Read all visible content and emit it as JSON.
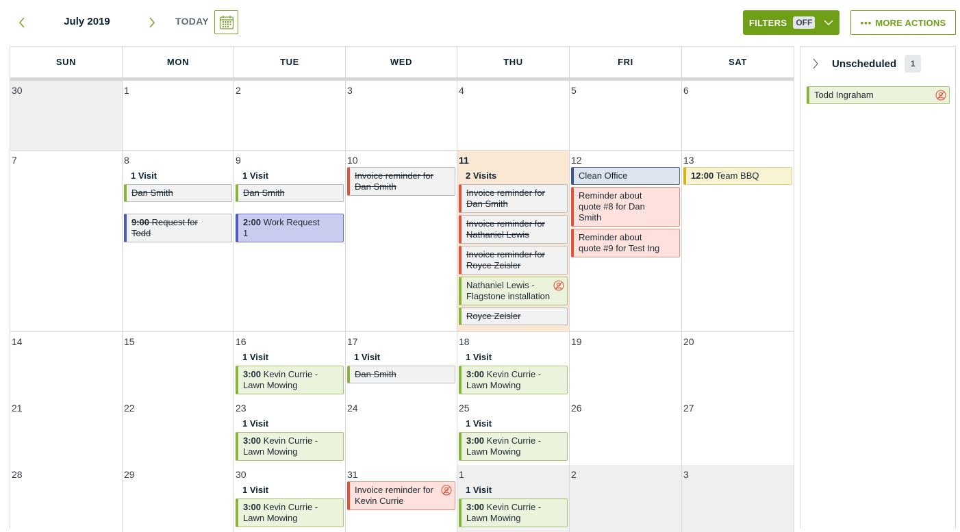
{
  "toolbar": {
    "month_title": "July 2019",
    "today_label": "TODAY",
    "filters_label": "FILTERS",
    "filters_state": "OFF",
    "more_actions_label": "MORE ACTIONS",
    "more_actions_dots": "•••"
  },
  "colors": {
    "brand_green": "#6f9f16",
    "today_bg": "#fae7d4",
    "outside_month_bg": "#efefef",
    "unassigned_icon": "#e0533a"
  },
  "weekdays": [
    "SUN",
    "MON",
    "TUE",
    "WED",
    "THU",
    "FRI",
    "SAT"
  ],
  "weeks": [
    {
      "days": [
        {
          "num": "30",
          "outside": true,
          "events": []
        },
        {
          "num": "1",
          "events": []
        },
        {
          "num": "2",
          "events": []
        },
        {
          "num": "3",
          "events": []
        },
        {
          "num": "4",
          "events": []
        },
        {
          "num": "5",
          "events": []
        },
        {
          "num": "6",
          "events": []
        }
      ]
    },
    {
      "days": [
        {
          "num": "7",
          "events": []
        },
        {
          "num": "8",
          "visits": "1 Visit",
          "events": [
            {
              "title": "Dan Smith",
              "style": "green-done",
              "done": true
            },
            {
              "gap": true
            },
            {
              "time": "9:00",
              "title": "Request for Todd",
              "style": "blue-done",
              "done": true
            }
          ]
        },
        {
          "num": "9",
          "visits": "1 Visit",
          "events": [
            {
              "title": "Dan Smith",
              "style": "green-done",
              "done": true
            },
            {
              "gap": true
            },
            {
              "time": "2:00",
              "title": "Work Request 1",
              "style": "blue"
            }
          ]
        },
        {
          "num": "10",
          "events": [
            {
              "title": "Invoice reminder for Dan Smith",
              "style": "red-done",
              "done": true
            }
          ]
        },
        {
          "num": "11",
          "today": true,
          "visits": "2 Visits",
          "events": [
            {
              "title": "Invoice reminder for Dan Smith",
              "style": "red-done",
              "done": true
            },
            {
              "title": "Invoice reminder for Nathaniel Lewis",
              "style": "red-done",
              "done": true
            },
            {
              "title": "Invoice reminder for Royce Zeisler",
              "style": "red-done",
              "done": true
            },
            {
              "title": "Nathaniel Lewis - Flagstone installation",
              "style": "green",
              "unassigned": true
            },
            {
              "title": "Royce Zeisler",
              "style": "green-done",
              "done": true
            }
          ]
        },
        {
          "num": "12",
          "events": [
            {
              "title": "Clean Office",
              "style": "slate"
            },
            {
              "title": "Reminder about quote #8 for Dan Smith",
              "style": "red"
            },
            {
              "title": "Reminder about quote #9 for Test Ing",
              "style": "red"
            }
          ]
        },
        {
          "num": "13",
          "events": [
            {
              "time": "12:00",
              "title": "Team BBQ",
              "style": "yellow"
            }
          ]
        }
      ]
    },
    {
      "days": [
        {
          "num": "14",
          "events": []
        },
        {
          "num": "15",
          "events": []
        },
        {
          "num": "16",
          "visits": "1 Visit",
          "events": [
            {
              "time": "3:00",
              "title": "Kevin Currie - Lawn Mowing",
              "style": "green"
            }
          ]
        },
        {
          "num": "17",
          "visits": "1 Visit",
          "events": [
            {
              "title": "Dan Smith",
              "style": "green-done",
              "done": true
            }
          ]
        },
        {
          "num": "18",
          "visits": "1 Visit",
          "events": [
            {
              "time": "3:00",
              "title": "Kevin Currie - Lawn Mowing",
              "style": "green"
            }
          ]
        },
        {
          "num": "19",
          "events": []
        },
        {
          "num": "20",
          "events": []
        }
      ]
    },
    {
      "days": [
        {
          "num": "21",
          "events": []
        },
        {
          "num": "22",
          "events": []
        },
        {
          "num": "23",
          "visits": "1 Visit",
          "events": [
            {
              "time": "3:00",
              "title": "Kevin Currie - Lawn Mowing",
              "style": "green"
            }
          ]
        },
        {
          "num": "24",
          "events": []
        },
        {
          "num": "25",
          "visits": "1 Visit",
          "events": [
            {
              "time": "3:00",
              "title": "Kevin Currie - Lawn Mowing",
              "style": "green"
            }
          ]
        },
        {
          "num": "26",
          "events": []
        },
        {
          "num": "27",
          "events": []
        }
      ]
    },
    {
      "days": [
        {
          "num": "28",
          "events": []
        },
        {
          "num": "29",
          "events": []
        },
        {
          "num": "30",
          "visits": "1 Visit",
          "events": [
            {
              "time": "3:00",
              "title": "Kevin Currie - Lawn Mowing",
              "style": "green"
            }
          ]
        },
        {
          "num": "31",
          "events": [
            {
              "title": "Invoice reminder for Kevin Currie",
              "style": "red",
              "unassigned": true
            }
          ]
        },
        {
          "num": "1",
          "outside": true,
          "visits": "1 Visit",
          "events": [
            {
              "time": "3:00",
              "title": "Kevin Currie - Lawn Mowing",
              "style": "green"
            }
          ]
        },
        {
          "num": "2",
          "outside": true,
          "events": []
        },
        {
          "num": "3",
          "outside": true,
          "events": []
        }
      ]
    }
  ],
  "sidebar": {
    "title": "Unscheduled",
    "count": "1",
    "items": [
      {
        "title": "Todd Ingraham",
        "style": "green",
        "unassigned": true
      }
    ]
  }
}
